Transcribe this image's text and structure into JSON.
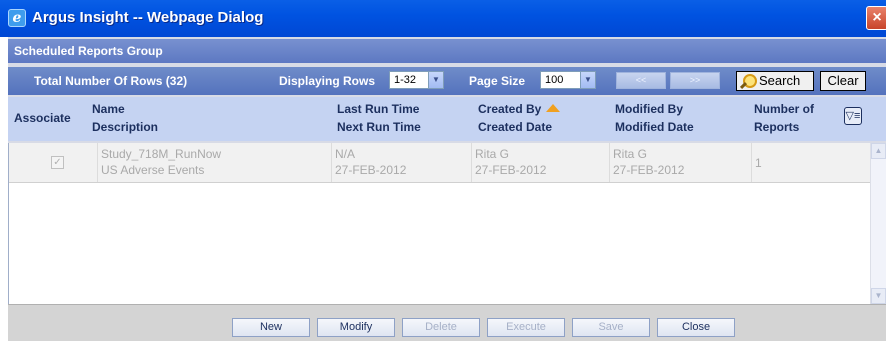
{
  "window": {
    "title": "Argus Insight -- Webpage Dialog",
    "close_glyph": "×"
  },
  "group": {
    "header": "Scheduled Reports Group"
  },
  "toolbar": {
    "total_rows": "Total Number Of Rows (32)",
    "displaying_rows_label": "Displaying Rows",
    "displaying_rows_value": "1-32",
    "page_size_label": "Page Size",
    "page_size_value": "100",
    "prev_glyph": "<<",
    "next_glyph": ">>",
    "search_label": "Search",
    "clear_label": "Clear"
  },
  "columns": {
    "associate": "Associate",
    "name": "Name",
    "description": "Description",
    "last_run_time": "Last Run Time",
    "next_run_time": "Next Run Time",
    "created_by": "Created By",
    "created_date": "Created Date",
    "modified_by": "Modified By",
    "modified_date": "Modified Date",
    "number_of": "Number of",
    "reports": "Reports"
  },
  "rows": [
    {
      "associated": true,
      "name": "Study_718M_RunNow",
      "description": "US Adverse Events",
      "last_run_time": "N/A",
      "next_run_time": "27-FEB-2012",
      "created_by": "Rita G",
      "created_date": "27-FEB-2012",
      "modified_by": "Rita G",
      "modified_date": "27-FEB-2012",
      "number_of_reports": "1"
    }
  ],
  "footer": {
    "new": "New",
    "modify": "Modify",
    "delete": "Delete",
    "execute": "Execute",
    "save": "Save",
    "close": "Close"
  },
  "colors": {
    "title_bar": "#0053e1",
    "header_bar": "#5d78c2",
    "column_header_bg": "#c5d3f2",
    "sort_arrow": "#f0a020",
    "disabled_text": "#a9a9a9"
  }
}
